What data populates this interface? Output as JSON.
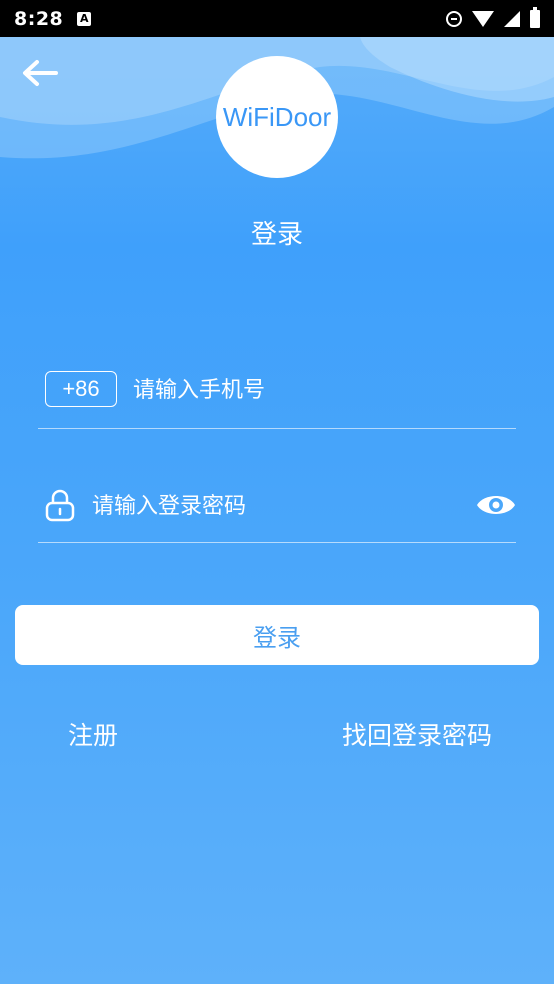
{
  "status_bar": {
    "time": "8:28",
    "notification_icon": "a-icon",
    "icons": [
      "dnd-icon",
      "wifi-icon",
      "signal-icon",
      "battery-icon"
    ]
  },
  "header": {
    "back_icon": "back-arrow-icon",
    "logo_text": "WiFiDoor",
    "title": "登录"
  },
  "form": {
    "country_code": "+86",
    "phone": {
      "value": "",
      "placeholder": "请输入手机号"
    },
    "password": {
      "value": "",
      "placeholder": "请输入登录密码",
      "lock_icon": "lock-icon",
      "visibility_icon": "eye-icon"
    }
  },
  "actions": {
    "login_label": "登录",
    "register_label": "注册",
    "forgot_label": "找回登录密码"
  },
  "colors": {
    "background": "#3fa0fb",
    "button_text": "#4a9ff0",
    "logo_text": "#3a97f6"
  }
}
